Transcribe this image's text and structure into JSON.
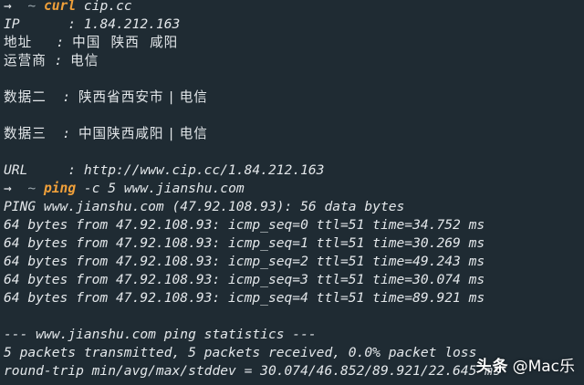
{
  "terminal": {
    "prompt_arrow": "→",
    "prompt_tilde": "~",
    "cmd1": {
      "command": "curl",
      "args": "cip.cc"
    },
    "ip": {
      "label": "IP      : ",
      "value": "1.84.212.163"
    },
    "addr": {
      "label": "地址",
      "sep": "   : ",
      "value": "中国  陕西  咸阳"
    },
    "isp": {
      "label": "运营商",
      "sep": " : ",
      "value": "电信"
    },
    "data2": {
      "label": "数据二",
      "sep": "  : ",
      "value": "陕西省西安市 | 电信"
    },
    "data3": {
      "label": "数据三",
      "sep": "  : ",
      "value": "中国陕西咸阳 | 电信"
    },
    "url": {
      "label": "URL     : ",
      "value": "http://www.cip.cc/1.84.212.163"
    },
    "cmd2": {
      "command": "ping",
      "args": "-c 5 www.jianshu.com"
    },
    "ping_header": "PING www.jianshu.com (47.92.108.93): 56 data bytes",
    "ping_lines": [
      "64 bytes from 47.92.108.93: icmp_seq=0 ttl=51 time=34.752 ms",
      "64 bytes from 47.92.108.93: icmp_seq=1 ttl=51 time=30.269 ms",
      "64 bytes from 47.92.108.93: icmp_seq=2 ttl=51 time=49.243 ms",
      "64 bytes from 47.92.108.93: icmp_seq=3 ttl=51 time=30.074 ms",
      "64 bytes from 47.92.108.93: icmp_seq=4 ttl=51 time=89.921 ms"
    ],
    "stats_header": "--- www.jianshu.com ping statistics ---",
    "stats_packets": "5 packets transmitted, 5 packets received, 0.0% packet loss",
    "stats_rtt": "round-trip min/avg/max/stddev = 30.074/46.852/89.921/22.645 ms"
  },
  "watermark": {
    "logo": "头条",
    "handle": "@Mac乐"
  }
}
